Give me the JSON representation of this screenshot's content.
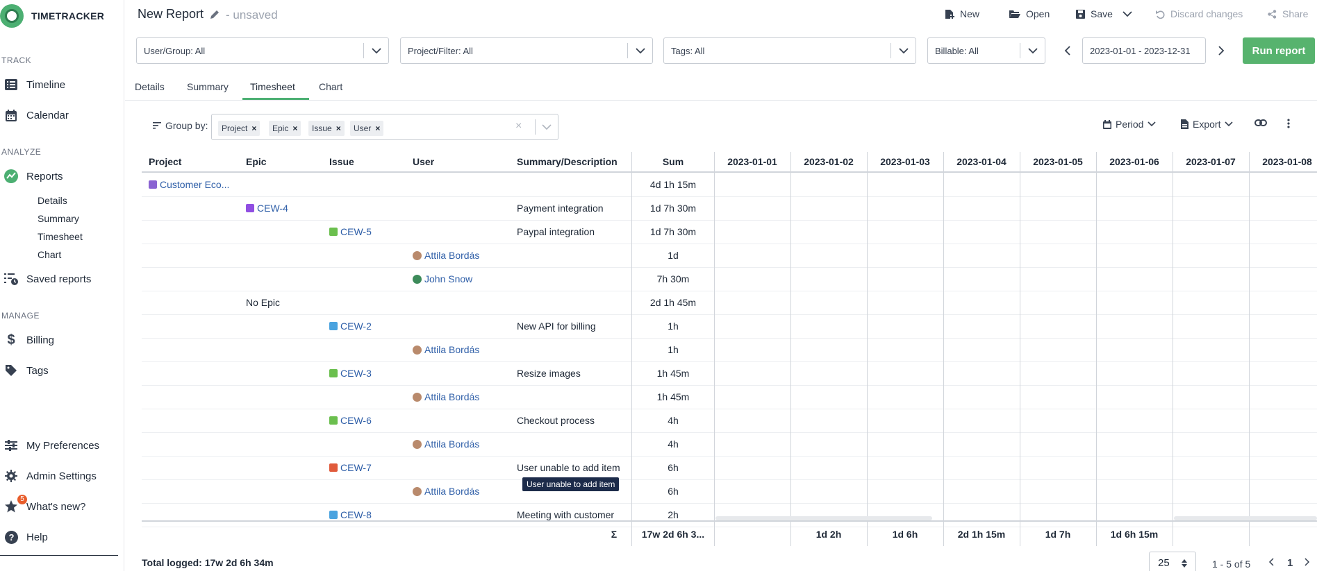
{
  "app": {
    "name": "TIMETRACKER"
  },
  "sidebar": {
    "track_title": "TRACK",
    "analyze_title": "ANALYZE",
    "manage_title": "MANAGE",
    "items": {
      "timeline": "Timeline",
      "calendar": "Calendar",
      "reports": "Reports",
      "details": "Details",
      "summary": "Summary",
      "timesheet": "Timesheet",
      "chart": "Chart",
      "saved_reports": "Saved reports",
      "billing": "Billing",
      "tags": "Tags",
      "my_preferences": "My Preferences",
      "admin_settings": "Admin Settings",
      "whats_new": "What's new?",
      "whats_new_count": "5",
      "help": "Help"
    }
  },
  "header": {
    "title": "New Report",
    "status": "- unsaved",
    "actions": {
      "new": "New",
      "open": "Open",
      "save": "Save",
      "discard": "Discard changes",
      "share": "Share"
    }
  },
  "filters": {
    "user_group": "User/Group: All",
    "project_filter": "Project/Filter: All",
    "tags": "Tags: All",
    "billable": "Billable: All",
    "date_range": "2023-01-01 - 2023-12-31",
    "run_report": "Run report"
  },
  "tabs": [
    "Details",
    "Summary",
    "Timesheet",
    "Chart"
  ],
  "group_by": {
    "label": "Group by:",
    "chips": [
      "Project",
      "Epic",
      "Issue",
      "User"
    ]
  },
  "tools": {
    "period": "Period",
    "export": "Export"
  },
  "table": {
    "columns": [
      "Project",
      "Epic",
      "Issue",
      "User",
      "Summary/Description",
      "Sum"
    ],
    "date_columns": [
      "2023-01-01",
      "2023-01-02",
      "2023-01-03",
      "2023-01-04",
      "2023-01-05",
      "2023-01-06",
      "2023-01-07",
      "2023-01-08"
    ],
    "rows": [
      {
        "project": "Customer Eco...",
        "epic": "",
        "issue": "",
        "user": "",
        "summary": "",
        "sum": "4d 1h 15m"
      },
      {
        "project": "",
        "epic": "CEW-4",
        "issue": "",
        "user": "",
        "summary": "Payment integration",
        "sum": "1d 7h 30m"
      },
      {
        "project": "",
        "epic": "",
        "issue": "CEW-5",
        "user": "",
        "summary": "Paypal integration",
        "sum": "1d 7h 30m"
      },
      {
        "project": "",
        "epic": "",
        "issue": "",
        "user": "Attila Bordás",
        "summary": "",
        "sum": "1d"
      },
      {
        "project": "",
        "epic": "",
        "issue": "",
        "user": "John Snow",
        "summary": "",
        "sum": "7h 30m"
      },
      {
        "project": "",
        "epic": "No Epic",
        "issue": "",
        "user": "",
        "summary": "",
        "sum": "2d 1h 45m"
      },
      {
        "project": "",
        "epic": "",
        "issue": "CEW-2",
        "user": "",
        "summary": "New API for billing",
        "sum": "1h"
      },
      {
        "project": "",
        "epic": "",
        "issue": "",
        "user": "Attila Bordás",
        "summary": "",
        "sum": "1h"
      },
      {
        "project": "",
        "epic": "",
        "issue": "CEW-3",
        "user": "",
        "summary": "Resize images",
        "sum": "1h 45m"
      },
      {
        "project": "",
        "epic": "",
        "issue": "",
        "user": "Attila Bordás",
        "summary": "",
        "sum": "1h 45m"
      },
      {
        "project": "",
        "epic": "",
        "issue": "CEW-6",
        "user": "",
        "summary": "Checkout process",
        "sum": "4h"
      },
      {
        "project": "",
        "epic": "",
        "issue": "",
        "user": "Attila Bordás",
        "summary": "",
        "sum": "4h"
      },
      {
        "project": "",
        "epic": "",
        "issue": "CEW-7",
        "user": "",
        "summary": "User unable to add item",
        "sum": "6h"
      },
      {
        "project": "",
        "epic": "",
        "issue": "",
        "user": "Attila Bordás",
        "summary": "",
        "sum": "6h"
      },
      {
        "project": "",
        "epic": "",
        "issue": "CEW-8",
        "user": "",
        "summary": "Meeting with customer",
        "sum": "2h"
      }
    ],
    "footer": {
      "sigma": "Σ",
      "sum": "17w 2d 6h 3...",
      "dates": [
        "",
        "1d 2h",
        "1d 6h",
        "2d 1h 15m",
        "1d 7h",
        "1d 6h 15m",
        "",
        ""
      ]
    },
    "tooltip": "User unable to add item"
  },
  "bottom": {
    "total_logged": "Total logged: 17w 2d 6h 34m",
    "page_size": "25",
    "page_info": "1 - 5 of 5",
    "current_page": "1"
  },
  "colors": {
    "accent": "#57b36e",
    "link": "#2f5fa8",
    "badge": "#e85d2c",
    "tooltip_bg": "#1c2b4a"
  }
}
